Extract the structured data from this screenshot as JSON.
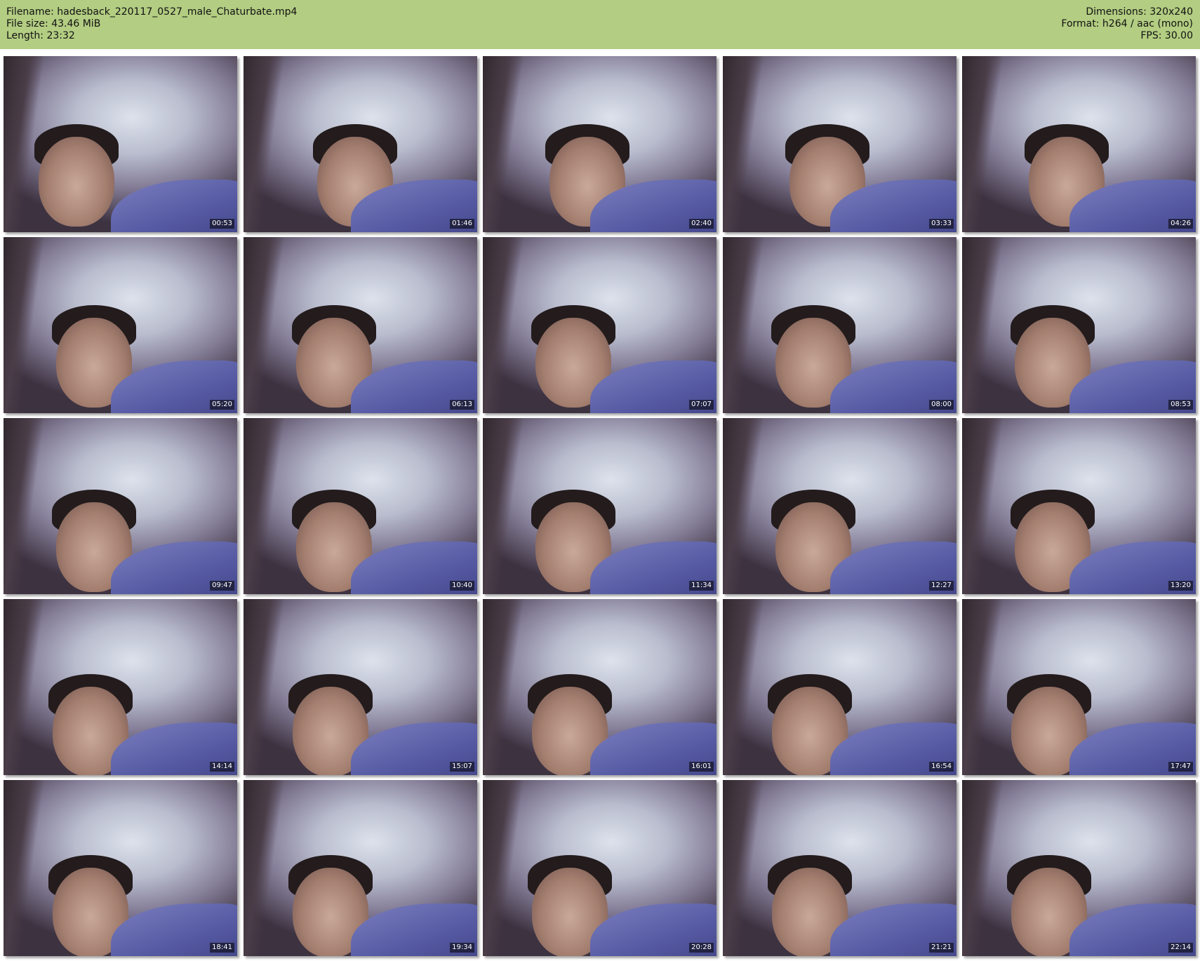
{
  "header": {
    "filename_line": "Filename: hadesback_220117_0527_male_Chaturbate.mp4",
    "filesize_line": "File size: 43.46 MiB",
    "length_line": "Length: 23:32",
    "dimensions_line": "Dimensions: 320x240",
    "format_line": "Format: h264 / aac (mono)",
    "fps_line": "FPS: 30.00"
  },
  "colors": {
    "header_bg": "#b3cd82",
    "page_bg": "#ffffff"
  },
  "thumbnails": [
    {
      "time": "00:53"
    },
    {
      "time": "01:46"
    },
    {
      "time": "02:40"
    },
    {
      "time": "03:33"
    },
    {
      "time": "04:26"
    },
    {
      "time": "05:20"
    },
    {
      "time": "06:13"
    },
    {
      "time": "07:07"
    },
    {
      "time": "08:00"
    },
    {
      "time": "08:53"
    },
    {
      "time": "09:47"
    },
    {
      "time": "10:40"
    },
    {
      "time": "11:34"
    },
    {
      "time": "12:27"
    },
    {
      "time": "13:20"
    },
    {
      "time": "14:14"
    },
    {
      "time": "15:07"
    },
    {
      "time": "16:01"
    },
    {
      "time": "16:54"
    },
    {
      "time": "17:47"
    },
    {
      "time": "18:41"
    },
    {
      "time": "19:34"
    },
    {
      "time": "20:28"
    },
    {
      "time": "21:21"
    },
    {
      "time": "22:14"
    }
  ]
}
